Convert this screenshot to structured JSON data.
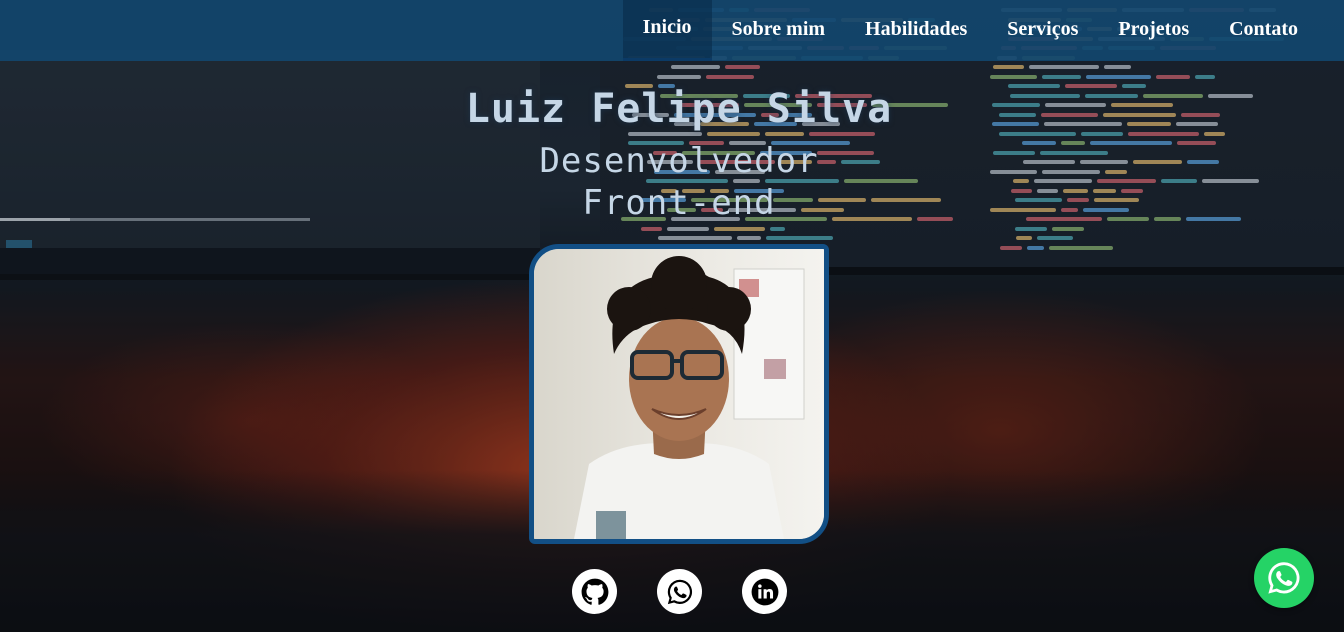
{
  "nav": {
    "items": [
      {
        "label": "Inicio",
        "active": true
      },
      {
        "label": "Sobre mim"
      },
      {
        "label": "Habilidades"
      },
      {
        "label": "Serviços"
      },
      {
        "label": "Projetos"
      },
      {
        "label": "Contato"
      }
    ]
  },
  "hero": {
    "name": "Luiz Felipe Silva",
    "role_line1": "Desenvolvedor",
    "role_line2": "Front-end"
  },
  "socials": [
    {
      "icon": "github-icon"
    },
    {
      "icon": "whatsapp-icon"
    },
    {
      "icon": "linkedin-icon"
    }
  ],
  "floating": {
    "icon": "whatsapp-icon",
    "color": "#25d366"
  },
  "colors": {
    "navbar": "#12466e",
    "accent": "#124f85",
    "hero_text": "#c5d6e6"
  }
}
